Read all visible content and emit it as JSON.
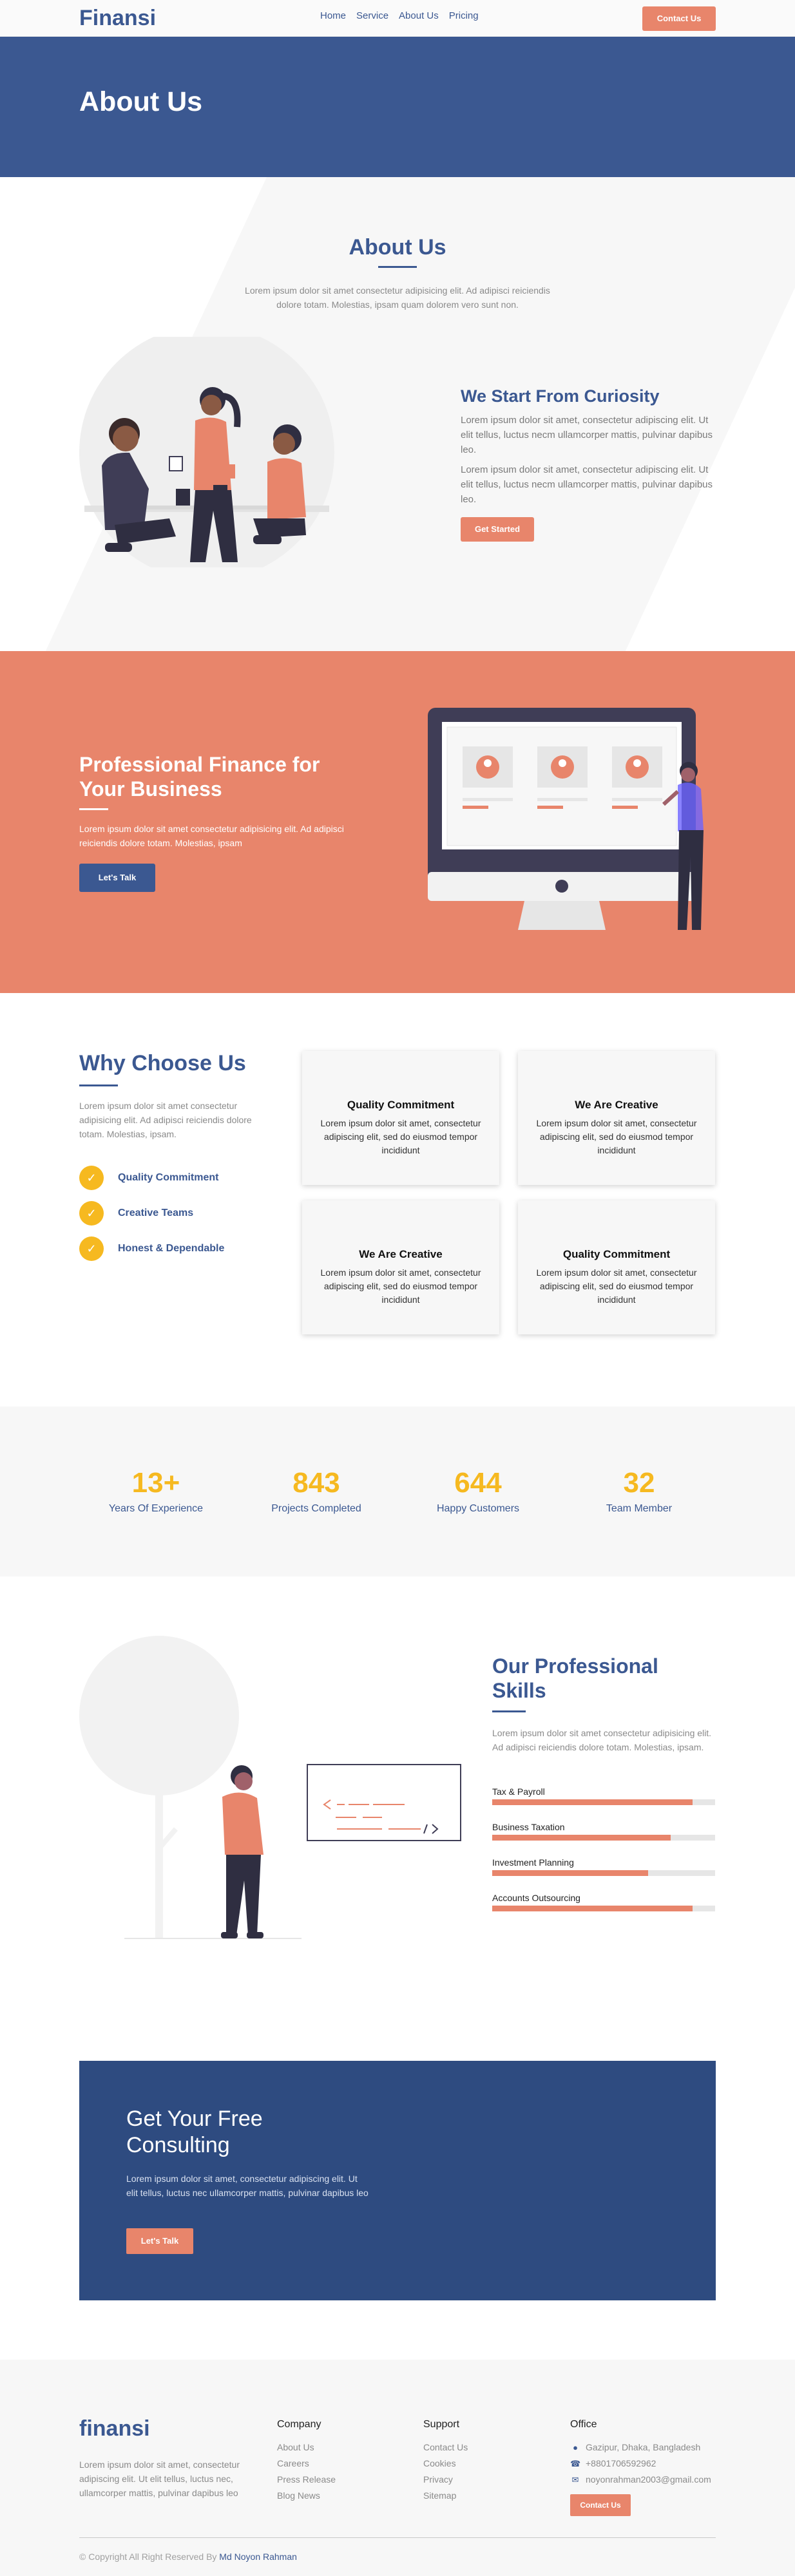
{
  "nav": {
    "logo": "Finansi",
    "menu": [
      "Home",
      "Service",
      "About Us",
      "Pricing"
    ],
    "contact_button": "Contact Us"
  },
  "hero": {
    "title": "About Us"
  },
  "about": {
    "title": "About Us",
    "intro": "Lorem ipsum dolor sit amet consectetur adipisicing elit. Ad adipisci reiciendis dolore totam. Molestias, ipsam quam dolorem vero sunt non.",
    "heading": "We Start From Curiosity",
    "para1": "Lorem ipsum dolor sit amet, consectetur adipiscing elit. Ut elit tellus, luctus necm ullamcorper mattis, pulvinar dapibus leo.",
    "para2": "Lorem ipsum dolor sit amet, consectetur adipiscing elit. Ut elit tellus, luctus necm ullamcorper mattis, pulvinar dapibus leo.",
    "button": "Get Started"
  },
  "finance": {
    "title": "Professional Finance for Your Business",
    "text": "Lorem ipsum dolor sit amet consectetur adipisicing elit. Ad adipisci reiciendis dolore totam. Molestias, ipsam",
    "button": "Let's Talk"
  },
  "why": {
    "title": "Why Choose Us",
    "lead": "Lorem ipsum dolor sit amet consectetur adipisicing elit. Ad adipisci reiciendis dolore totam. Molestias, ipsam.",
    "checks": [
      "Quality Commitment",
      "Creative Teams",
      "Honest & Dependable"
    ],
    "cards": [
      {
        "title": "Quality Commitment",
        "text": "Lorem ipsum dolor sit amet, consectetur adipiscing elit, sed do eiusmod tempor incididunt"
      },
      {
        "title": "We Are Creative",
        "text": "Lorem ipsum dolor sit amet, consectetur adipiscing elit, sed do eiusmod tempor incididunt"
      },
      {
        "title": "We Are Creative",
        "text": "Lorem ipsum dolor sit amet, consectetur adipiscing elit, sed do eiusmod tempor incididunt"
      },
      {
        "title": "Quality Commitment",
        "text": "Lorem ipsum dolor sit amet, consectetur adipiscing elit, sed do eiusmod tempor incididunt"
      }
    ]
  },
  "stats": [
    {
      "value": "13+",
      "label": "Years Of Experience"
    },
    {
      "value": "843",
      "label": "Projects Completed"
    },
    {
      "value": "644",
      "label": "Happy Customers"
    },
    {
      "value": "32",
      "label": "Team Member"
    }
  ],
  "skills": {
    "title": "Our Professional Skills",
    "lead": "Lorem ipsum dolor sit amet consectetur adipisicing elit. Ad adipisci reiciendis dolore totam. Molestias, ipsam.",
    "items": [
      {
        "name": "Tax & Payroll",
        "percent": 90
      },
      {
        "name": "Business Taxation",
        "percent": 80
      },
      {
        "name": "Investment Planning",
        "percent": 70
      },
      {
        "name": "Accounts Outsourcing",
        "percent": 90
      }
    ]
  },
  "cta": {
    "title": "Get Your Free Consulting",
    "text": "Lorem ipsum dolor sit amet, consectetur adipiscing elit. Ut elit tellus, luctus nec ullamcorper mattis, pulvinar dapibus leo",
    "button": "Let's Talk"
  },
  "footer": {
    "logo": "finansi",
    "about": "Lorem ipsum dolor sit amet, consectetur adipiscing elit. Ut elit tellus, luctus nec, ullamcorper mattis, pulvinar dapibus leo",
    "company": {
      "title": "Company",
      "links": [
        "About Us",
        "Careers",
        "Press Release",
        "Blog News"
      ]
    },
    "support": {
      "title": "Support",
      "links": [
        "Contact Us",
        "Cookies",
        "Privacy",
        "Sitemap"
      ]
    },
    "office": {
      "title": "Office",
      "address": "Gazipur, Dhaka, Bangladesh",
      "phone": "+8801706592962",
      "email": "noyonrahman2003@gmail.com",
      "button": "Contact Us"
    },
    "copyright": "© Copyright All Right Reserved By",
    "author": "Md Noyon Rahman"
  },
  "colors": {
    "navy": "#3b5891",
    "coral": "#e8856b",
    "gold": "#f6b920",
    "dark_navy": "#2e4b80"
  },
  "icons": {
    "check": "check-icon",
    "location": "location-icon",
    "phone": "phone-icon",
    "email": "email-icon"
  }
}
